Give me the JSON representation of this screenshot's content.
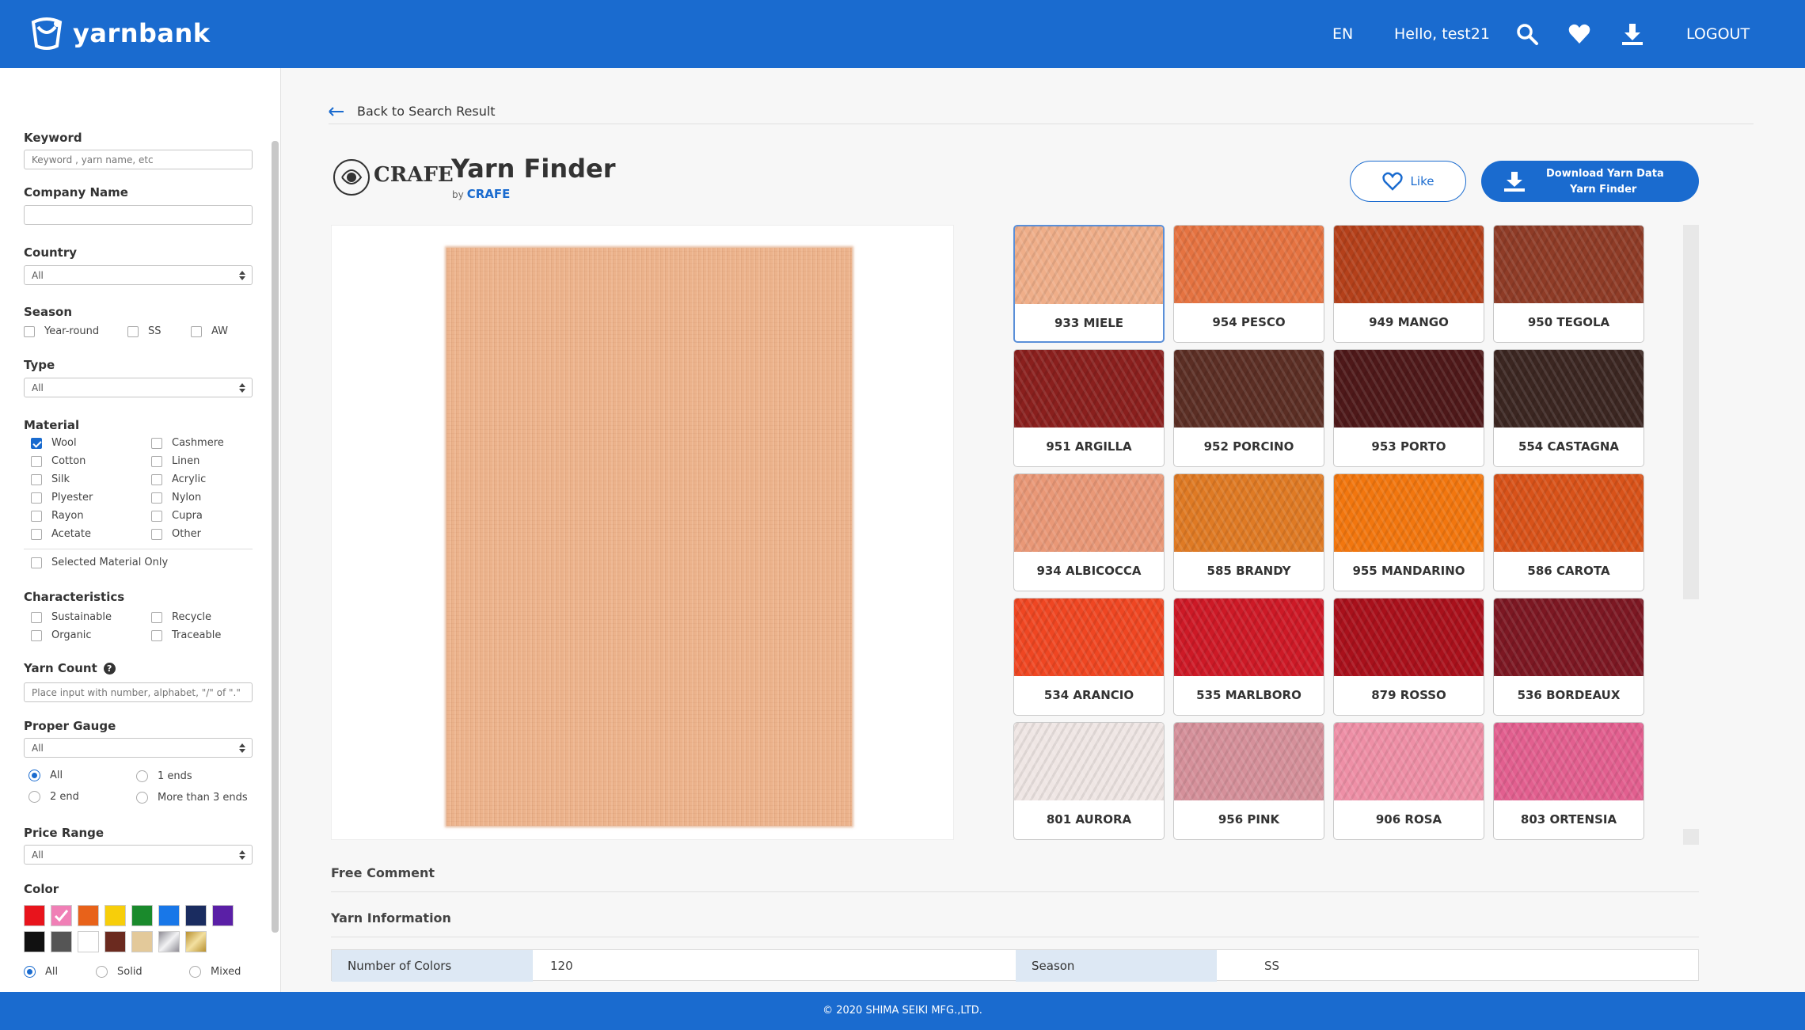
{
  "header": {
    "logo_text": "yarnbank",
    "lang": "EN",
    "greeting": "Hello, test21",
    "logout": "LOGOUT",
    "icons": [
      "search-icon",
      "heart-icon",
      "download-icon"
    ]
  },
  "sidebar": {
    "keyword": {
      "label": "Keyword",
      "placeholder": "Keyword , yarn name, etc"
    },
    "company": {
      "label": "Company Name",
      "placeholder": ""
    },
    "country": {
      "label": "Country",
      "value": "All"
    },
    "season": {
      "label": "Season",
      "options": [
        "Year-round",
        "SS",
        "AW"
      ]
    },
    "type": {
      "label": "Type",
      "value": "All"
    },
    "material": {
      "label": "Material",
      "options": [
        {
          "name": "Wool",
          "checked": true
        },
        {
          "name": "Cashmere",
          "checked": false
        },
        {
          "name": "Cotton",
          "checked": false
        },
        {
          "name": "Linen",
          "checked": false
        },
        {
          "name": "Silk",
          "checked": false
        },
        {
          "name": "Acrylic",
          "checked": false
        },
        {
          "name": "Plyester",
          "checked": false
        },
        {
          "name": "Nylon",
          "checked": false
        },
        {
          "name": "Rayon",
          "checked": false
        },
        {
          "name": "Cupra",
          "checked": false
        },
        {
          "name": "Acetate",
          "checked": false
        },
        {
          "name": "Other",
          "checked": false
        }
      ],
      "selected_only": "Selected Material Only"
    },
    "characteristics": {
      "label": "Characteristics",
      "options": [
        "Sustainable",
        "Recycle",
        "Organic",
        "Traceable"
      ]
    },
    "yarn_count": {
      "label": "Yarn Count",
      "placeholder": "Place input with number, alphabet, \"/\" of \".\""
    },
    "gauge": {
      "label": "Proper Gauge",
      "value": "All",
      "ends": [
        "All",
        "1 ends",
        "2 end",
        "More than 3 ends"
      ]
    },
    "price": {
      "label": "Price Range",
      "value": "All"
    },
    "color": {
      "label": "Color",
      "swatches": [
        "#e8141c",
        "#f07fb6",
        "#e8621a",
        "#f7ce0a",
        "#1a8a2c",
        "#1877e8",
        "#1a2c60",
        "#5a1fa6",
        "#111111",
        "#555555",
        "#ffffff",
        "#6b2a1f",
        "#e3c99a",
        "#b9b7bd",
        "#cfa74c"
      ],
      "modes": [
        "All",
        "Solid",
        "Mixed"
      ]
    }
  },
  "main": {
    "back": "Back to Search Result",
    "brand": "CRAFE",
    "title": "Yarn Finder",
    "by": "by",
    "like": "Like",
    "download_line1": "Download Yarn Data",
    "download_line2": "Yarn Finder",
    "colors": [
      {
        "name": "933 MIELE",
        "hex": "#efae89"
      },
      {
        "name": "954 PESCO",
        "hex": "#e57341"
      },
      {
        "name": "949 MANGO",
        "hex": "#b4401a"
      },
      {
        "name": "950 TEGOLA",
        "hex": "#8e3b26"
      },
      {
        "name": "951 ARGILLA",
        "hex": "#8a1f1d"
      },
      {
        "name": "952 PORCINO",
        "hex": "#5b2e24"
      },
      {
        "name": "953 PORTO",
        "hex": "#4e1819"
      },
      {
        "name": "554 CASTAGNA",
        "hex": "#3b2621"
      },
      {
        "name": "934 ALBICOCCA",
        "hex": "#e99877"
      },
      {
        "name": "585 BRANDY",
        "hex": "#df7a24"
      },
      {
        "name": "955 MANDARINO",
        "hex": "#f2760e"
      },
      {
        "name": "586 CAROTA",
        "hex": "#d85219"
      },
      {
        "name": "534 ARANCIO",
        "hex": "#ef4622"
      },
      {
        "name": "535 MARLBORO",
        "hex": "#cd1926"
      },
      {
        "name": "879 ROSSO",
        "hex": "#a9101b"
      },
      {
        "name": "536 BORDEAUX",
        "hex": "#7c1722"
      },
      {
        "name": "801 AURORA",
        "hex": "#efe6e4"
      },
      {
        "name": "956 PINK",
        "hex": "#d5909a"
      },
      {
        "name": "906 ROSA",
        "hex": "#ee8fa6"
      },
      {
        "name": "803 ORTENSIA",
        "hex": "#e25f8f"
      }
    ],
    "free_comment": "Free Comment",
    "yarn_info": "Yarn Information",
    "info": {
      "colors_label": "Number of Colors",
      "colors_value": "120",
      "season_label": "Season",
      "season_value": "SS"
    }
  },
  "footer": "© 2020 SHIMA SEIKI MFG.,LTD."
}
